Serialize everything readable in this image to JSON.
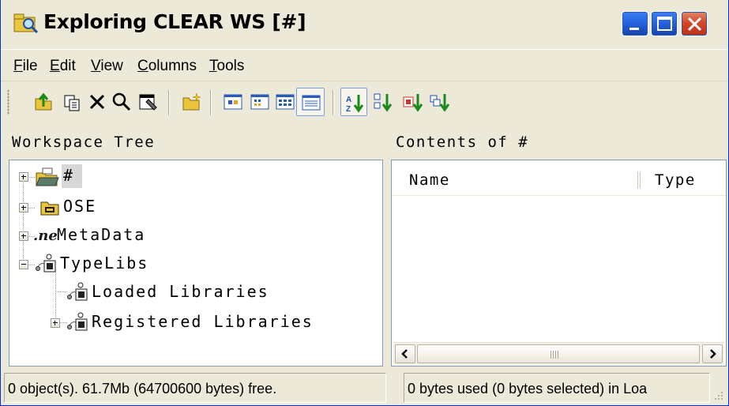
{
  "window": {
    "title": "Exploring CLEAR WS [#]",
    "controls": [
      "minimize",
      "maximize",
      "close"
    ]
  },
  "menu": [
    {
      "label": "File",
      "mnemonic": "F",
      "rest": "ile"
    },
    {
      "label": "Edit",
      "mnemonic": "E",
      "rest": "dit"
    },
    {
      "label": "View",
      "mnemonic": "V",
      "rest": "iew"
    },
    {
      "label": "Columns",
      "mnemonic": "C",
      "rest": "olumns"
    },
    {
      "label": "Tools",
      "mnemonic": "T",
      "rest": "ools"
    }
  ],
  "toolbar": {
    "buttons": [
      "up-folder-icon",
      "copy-icon",
      "delete-icon",
      "find-icon",
      "properties-icon",
      "new-folder-icon",
      "large-icons-view-icon",
      "small-icons-view-icon",
      "list-view-icon",
      "details-view-icon",
      "sort-by-name-icon",
      "sort-by-type-icon",
      "sort-by-size-icon",
      "sort-by-date-icon"
    ],
    "active": "details-view-icon"
  },
  "left_pane": {
    "header": "Workspace Tree",
    "tree": [
      {
        "label": "#",
        "icon": "workspace-folder-icon",
        "expander": "plus",
        "selected": true
      },
      {
        "label": "OSE",
        "icon": "ose-folder-icon",
        "expander": "plus"
      },
      {
        "label": "MetaData",
        "icon": "net-icon",
        "expander": "plus"
      },
      {
        "label": "TypeLibs",
        "icon": "typelib-icon",
        "expander": "minus",
        "children": [
          {
            "label": "Loaded Libraries",
            "icon": "typelib-icon",
            "expander": "none"
          },
          {
            "label": "Registered Libraries",
            "icon": "typelib-icon",
            "expander": "plus"
          }
        ]
      }
    ]
  },
  "right_pane": {
    "header": "Contents of #",
    "columns": [
      "Name",
      "Type"
    ],
    "rows": []
  },
  "statusbar": {
    "left": "0 object(s). 61.7Mb (64700600 bytes) free.",
    "right": "0 bytes used (0 bytes selected) in Loa"
  },
  "colors": {
    "face": "#ece9d8",
    "border": "#7f9db9",
    "title_button_blue": "#2663de",
    "close_red": "#d5492a"
  }
}
